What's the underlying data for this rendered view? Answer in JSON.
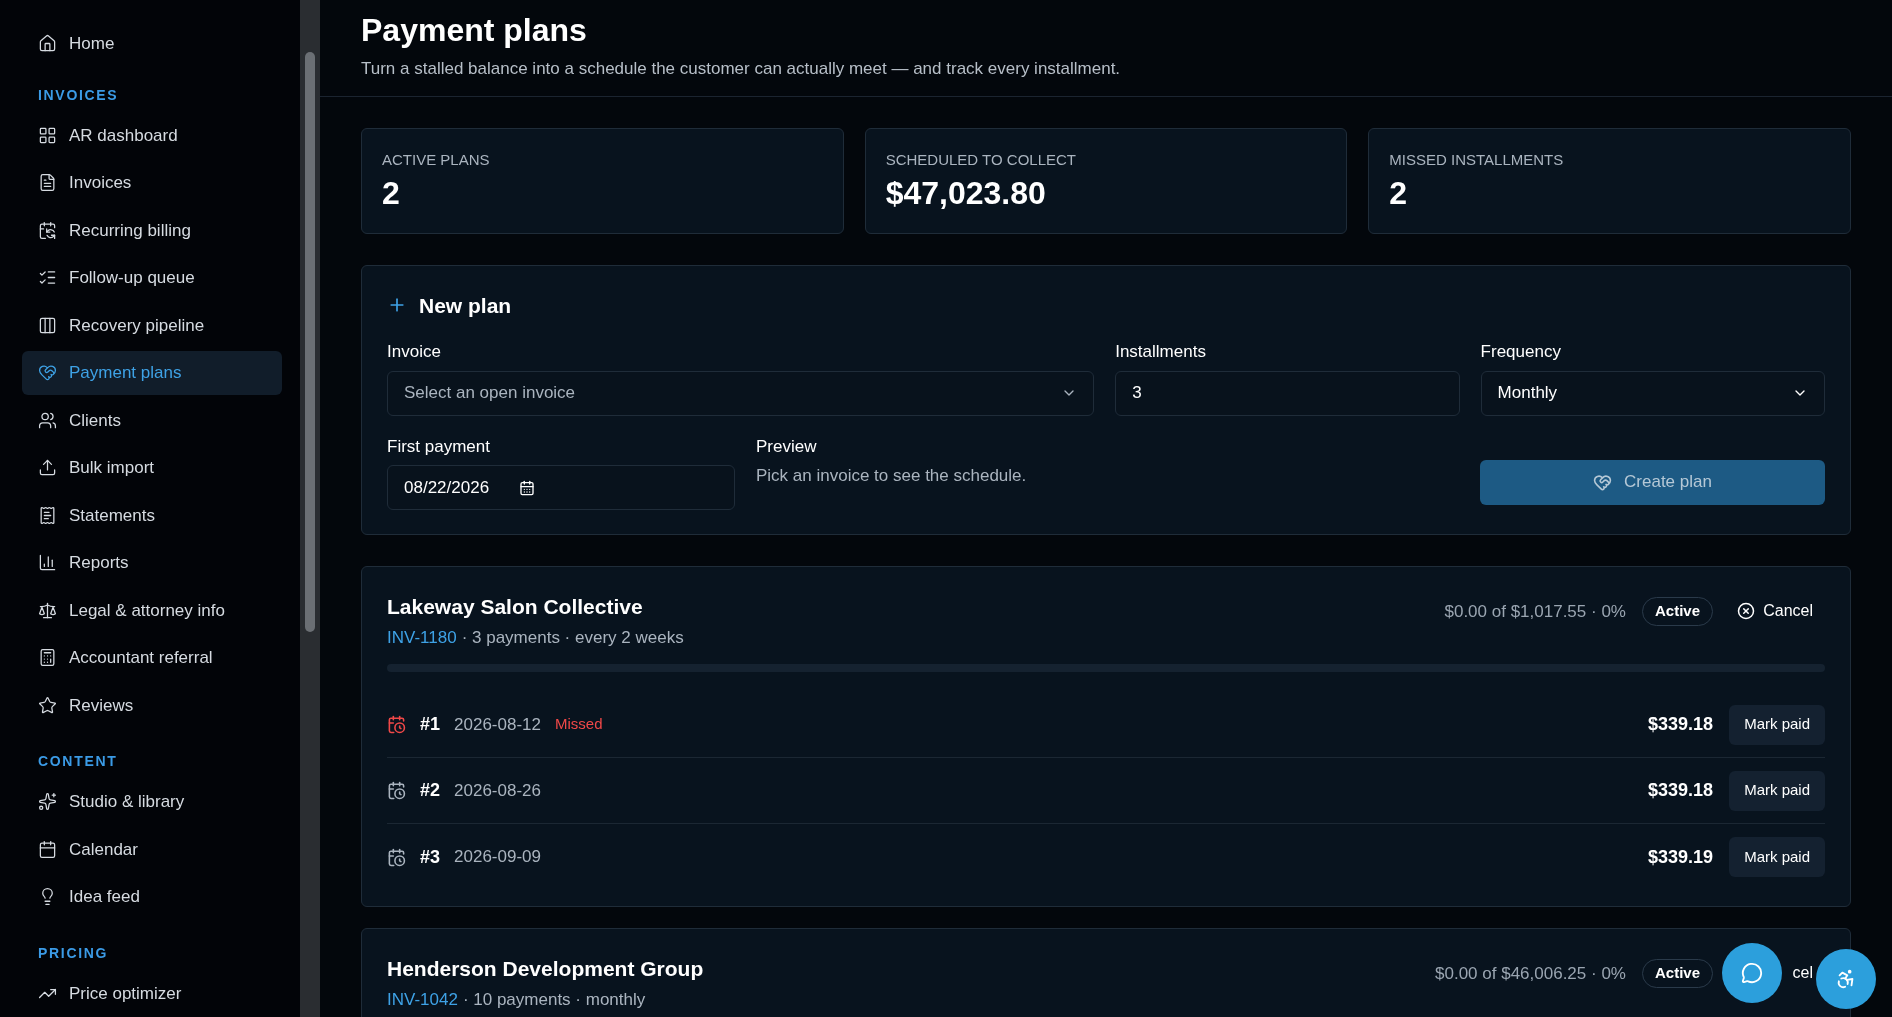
{
  "sidebar": {
    "items": [
      {
        "label": "Home",
        "selected": false
      }
    ],
    "sections": [
      {
        "title": "INVOICES",
        "items": [
          {
            "label": "AR dashboard",
            "selected": false
          },
          {
            "label": "Invoices",
            "selected": false
          },
          {
            "label": "Recurring billing",
            "selected": false
          },
          {
            "label": "Follow-up queue",
            "selected": false
          },
          {
            "label": "Recovery pipeline",
            "selected": false
          },
          {
            "label": "Payment plans",
            "selected": true
          },
          {
            "label": "Clients",
            "selected": false
          },
          {
            "label": "Bulk import",
            "selected": false
          },
          {
            "label": "Statements",
            "selected": false
          },
          {
            "label": "Reports",
            "selected": false
          },
          {
            "label": "Legal & attorney info",
            "selected": false
          },
          {
            "label": "Accountant referral",
            "selected": false
          },
          {
            "label": "Reviews",
            "selected": false
          }
        ]
      },
      {
        "title": "CONTENT",
        "items": [
          {
            "label": "Studio & library",
            "selected": false
          },
          {
            "label": "Calendar",
            "selected": false
          },
          {
            "label": "Idea feed",
            "selected": false
          }
        ]
      },
      {
        "title": "PRICING",
        "items": [
          {
            "label": "Price optimizer",
            "selected": false
          }
        ]
      }
    ]
  },
  "header": {
    "title": "Payment plans",
    "subtitle": "Turn a stalled balance into a schedule the customer can actually meet — and track every installment."
  },
  "stats": [
    {
      "label": "ACTIVE PLANS",
      "value": "2"
    },
    {
      "label": "SCHEDULED TO COLLECT",
      "value": "$47,023.80"
    },
    {
      "label": "MISSED INSTALLMENTS",
      "value": "2"
    }
  ],
  "new_plan": {
    "title": "New plan",
    "invoice": {
      "label": "Invoice",
      "placeholder": "Select an open invoice"
    },
    "installments": {
      "label": "Installments",
      "value": "3"
    },
    "frequency": {
      "label": "Frequency",
      "value": "Monthly"
    },
    "first_payment": {
      "label": "First payment",
      "value": "08/22/2026"
    },
    "preview": {
      "label": "Preview",
      "text": "Pick an invoice to see the schedule."
    },
    "create_button": "Create plan"
  },
  "plans": [
    {
      "name": "Lakeway Salon Collective",
      "invoice": "INV-1180",
      "details": "· 3 payments · every 2 weeks",
      "progress": "$0.00 of $1,017.55 · 0%",
      "status": "Active",
      "cancel": "Cancel",
      "cancel_icon": true,
      "level": 0,
      "installments": [
        {
          "number": "#1",
          "date": "2026-08-12",
          "missed": true,
          "missed_label": "Missed",
          "amount": "$339.18",
          "action": "Mark paid"
        },
        {
          "number": "#2",
          "date": "2026-08-26",
          "missed": false,
          "amount": "$339.18",
          "action": "Mark paid"
        },
        {
          "number": "#3",
          "date": "2026-09-09",
          "missed": false,
          "amount": "$339.19",
          "action": "Mark paid"
        }
      ]
    },
    {
      "name": "Henderson Development Group",
      "invoice": "INV-1042",
      "details": "· 10 payments · monthly",
      "progress": "$0.00 of $46,006.25 · 0%",
      "status": "Active",
      "cancel": "cel",
      "cancel_icon": false
    }
  ]
}
